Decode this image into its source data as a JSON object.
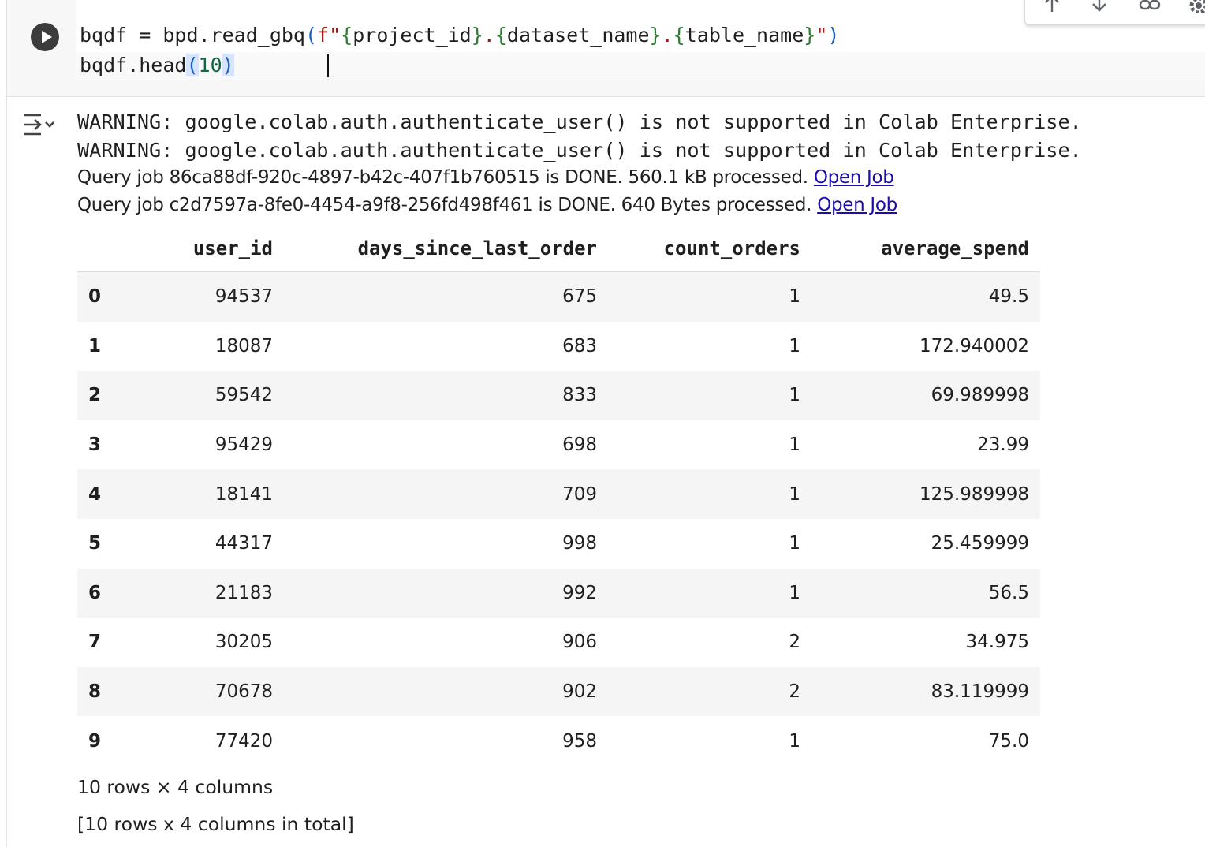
{
  "code_cell": {
    "line1": {
      "prefix": "bqdf = bpd.read_gbq",
      "open_paren": "(",
      "fstr_open": "f\"",
      "brace_open_1": "{",
      "var_1": "project_id",
      "brace_close_1": "}",
      "dot_1": ".",
      "brace_open_2": "{",
      "var_2": "dataset_name",
      "brace_close_2": "}",
      "dot_2": ".",
      "brace_open_3": "{",
      "var_3": "table_name",
      "brace_close_3": "}",
      "fstr_close": "\"",
      "close_paren": ")"
    },
    "line2": {
      "prefix": "bqdf.head",
      "open_paren": "(",
      "arg": "10",
      "close_paren": ")"
    }
  },
  "output": {
    "warnings": [
      "WARNING: google.colab.auth.authenticate_user() is not supported in Colab Enterprise.",
      "WARNING: google.colab.auth.authenticate_user() is not supported in Colab Enterprise."
    ],
    "jobs": [
      {
        "text": "Query job 86ca88df-920c-4897-b42c-407f1b760515 is DONE. 560.1 kB processed. ",
        "link": "Open Job"
      },
      {
        "text": "Query job c2d7597a-8fe0-4454-a9f8-256fd498f461 is DONE. 640 Bytes processed. ",
        "link": "Open Job"
      }
    ],
    "table": {
      "columns": [
        "",
        "user_id",
        "days_since_last_order",
        "count_orders",
        "average_spend"
      ],
      "rows": [
        [
          "0",
          "94537",
          "675",
          "1",
          "49.5"
        ],
        [
          "1",
          "18087",
          "683",
          "1",
          "172.940002"
        ],
        [
          "2",
          "59542",
          "833",
          "1",
          "69.989998"
        ],
        [
          "3",
          "95429",
          "698",
          "1",
          "23.99"
        ],
        [
          "4",
          "18141",
          "709",
          "1",
          "125.989998"
        ],
        [
          "5",
          "44317",
          "998",
          "1",
          "25.459999"
        ],
        [
          "6",
          "21183",
          "992",
          "1",
          "56.5"
        ],
        [
          "7",
          "30205",
          "906",
          "2",
          "34.975"
        ],
        [
          "8",
          "70678",
          "902",
          "2",
          "83.119999"
        ],
        [
          "9",
          "77420",
          "958",
          "1",
          "75.0"
        ]
      ]
    },
    "summary_1": "10 rows × 4 columns",
    "summary_2": "[10 rows x 4 columns in total]"
  },
  "icons": {
    "run": "play-icon",
    "output_toggle": "output-toggle-icon",
    "toolbar": [
      "move-up-icon",
      "move-down-icon",
      "link-icon",
      "gear-icon"
    ]
  }
}
